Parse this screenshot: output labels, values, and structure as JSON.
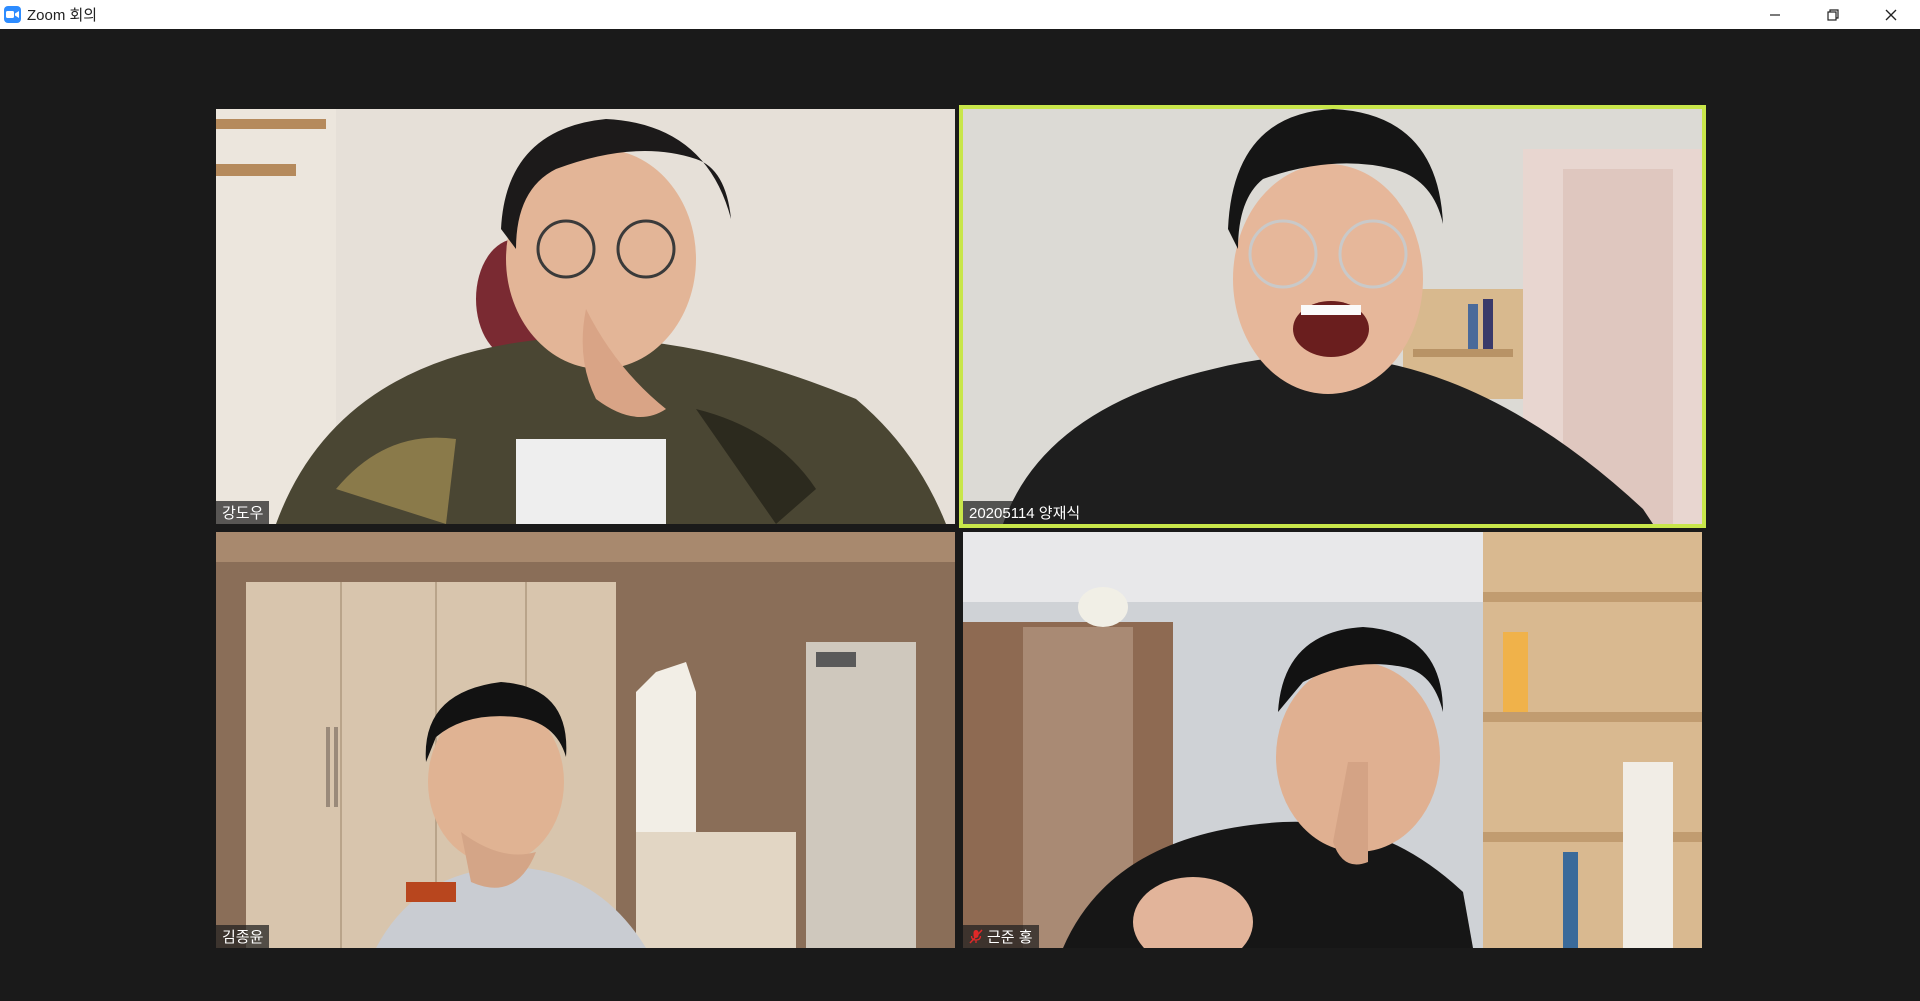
{
  "window": {
    "title": "Zoom 회의",
    "app_icon": "zoom-camera-icon",
    "controls": [
      "minimize-icon",
      "restore-icon",
      "close-icon"
    ]
  },
  "accent": {
    "active_speaker_border": "#c8e64a",
    "zoom_blue": "#2d8cff",
    "mute_red": "#e02828"
  },
  "participants": [
    {
      "name": "강도우",
      "muted": false,
      "active_speaker": false
    },
    {
      "name": "20205114 양재식",
      "muted": false,
      "active_speaker": true
    },
    {
      "name": "김종윤",
      "muted": false,
      "active_speaker": false
    },
    {
      "name": "근준 홍",
      "muted": true,
      "active_speaker": false
    }
  ]
}
